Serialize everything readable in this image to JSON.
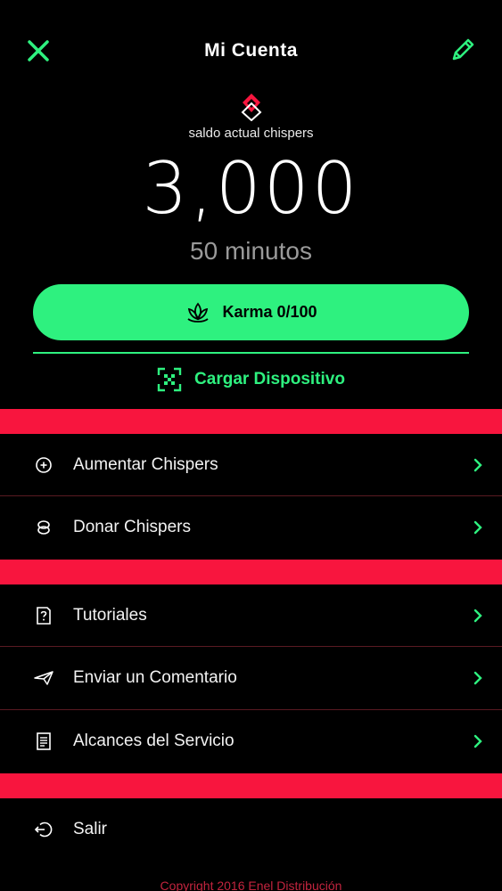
{
  "header": {
    "title": "Mi Cuenta",
    "close_icon": "close-icon",
    "edit_icon": "pencil-icon"
  },
  "balance": {
    "label": "saldo actual chispers",
    "amount": "3,000",
    "minutes": "50 minutos"
  },
  "karma_button": {
    "label": "Karma 0/100",
    "icon": "lotus-icon"
  },
  "charge_link": {
    "label": "Cargar Dispositivo",
    "icon": "qr-scan-icon"
  },
  "menu_group_1": [
    {
      "label": "Aumentar Chispers",
      "icon": "plus-circle-icon"
    },
    {
      "label": "Donar Chispers",
      "icon": "coins-icon"
    }
  ],
  "menu_group_2": [
    {
      "label": "Tutoriales",
      "icon": "help-document-icon"
    },
    {
      "label": "Enviar un Comentario",
      "icon": "paper-plane-icon"
    },
    {
      "label": "Alcances del Servicio",
      "icon": "document-icon"
    }
  ],
  "menu_group_3": [
    {
      "label": "Salir",
      "icon": "logout-icon"
    }
  ],
  "footer": {
    "copyright": "Copyright 2016 Enel Distribución"
  },
  "colors": {
    "accent_green": "#2ef17f",
    "band_red": "#f8153e",
    "background": "#000000"
  }
}
